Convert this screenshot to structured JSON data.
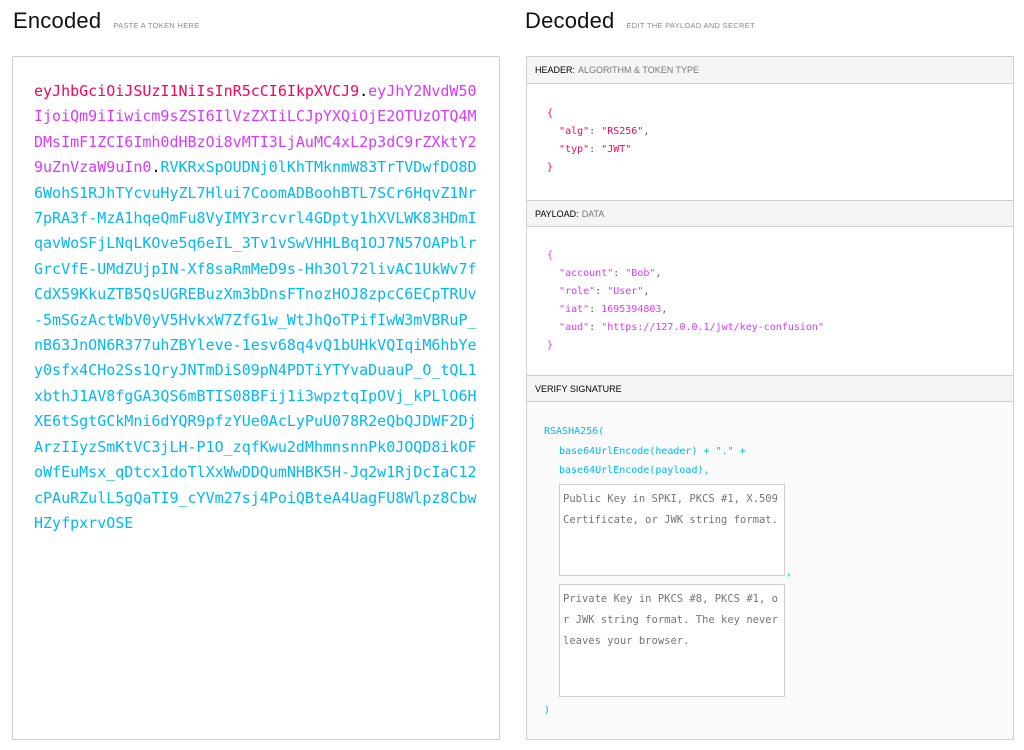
{
  "encoded": {
    "title": "Encoded",
    "subtitle": "PASTE A TOKEN HERE",
    "token": {
      "header": "eyJhbGciOiJSUzI1NiIsInR5cCI6IkpXVCJ9",
      "payload": "eyJhY2NvdW50IjoiQm9iIiwicm9sZSI6IlVzZXIiLCJpYXQiOjE2OTUzOTQ4MDMsImF1ZCI6Imh0dHBzOi8vMTI3LjAuMC4xL2p3dC9rZXktY29uZnVzaW9uIn0",
      "signature": "RVKRxSpOUDNj0lKhTMknmW83TrTVDwfDO8D6WohS1RJhTYcvuHyZL7Hlui7CoomADBoohBTL7SCr6HqvZ1Nr7pRA3f-MzA1hqeQmFu8VyIMY3rcvrl4GDpty1hXVLWK83HDmIqavWoSFjLNqLKOve5q6eIL_3Tv1vSwVHHLBq1OJ7N57OAPblrGrcVfE-UMdZUjpIN-Xf8saRmMeD9s-Hh3Ol72livAC1UkWv7fCdX59KkuZTB5QsUGREBuzXm3bDnsFTnozHOJ8zpcC6ECpTRUv-5mSGzActWbV0yV5HvkxW7ZfG1w_WtJhQoTPifIwW3mVBRuP_nB63JnON6R377uhZBYleve-1esv68q4vQ1bUHkVQIqiM6hbYey0sfx4CHo2Ss1QryJNTmDiS09pN4PDTiYTYvaDuauP_O_tQL1xbthJ1AV8fgGA3QS6mBTIS08BFij1i3wpztqIpOVj_kPLlO6HXE6tSgtGCkMni6dYQR9pfzYUe0AcLyPuU078R2eQbQJDWF2DjArzIIyzSmKtVC3jLH-P1O_zqfKwu2dMhmnsnnPk0JOQD8ikOFoWfEuMsx_qDtcx1doTlXxWwDDQumNHBK5H-Jq2w1RjDcIaC12cPAuRZulL5gQaTI9_cYVm27sj4PoiQBteA4UagFU8Wlpz8CbwHZyfpxrvOSE"
    }
  },
  "decoded": {
    "title": "Decoded",
    "subtitle": "EDIT THE PAYLOAD AND SECRET",
    "header_section": {
      "label": "HEADER:",
      "sub": "ALGORITHM & TOKEN TYPE"
    },
    "payload_section": {
      "label": "PAYLOAD:",
      "sub": "DATA"
    },
    "verify_section": {
      "label": "VERIFY SIGNATURE"
    },
    "header_json": {
      "alg": "\"RS256\"",
      "typ": "\"JWT\""
    },
    "payload_json": {
      "account": "\"Bob\"",
      "role": "\"User\"",
      "iat": "1695394803",
      "aud": "\"https://127.0.0.1/jwt/key-confusion\""
    },
    "verify": {
      "func": "RSASHA256(",
      "line1": "base64UrlEncode(header) + \".\" +",
      "line2": "base64UrlEncode(payload),",
      "comma": ",",
      "close": ")",
      "public_key_placeholder": "Public Key in SPKI, PKCS #1, X.509 Certificate, or JWK string format.",
      "private_key_placeholder": "Private Key in PKCS #8, PKCS #1, or JWK string format. The key never leaves your browser."
    }
  },
  "colors": {
    "header": "#fb015b",
    "payload": "#d63aff",
    "signature": "#00b9f1"
  }
}
